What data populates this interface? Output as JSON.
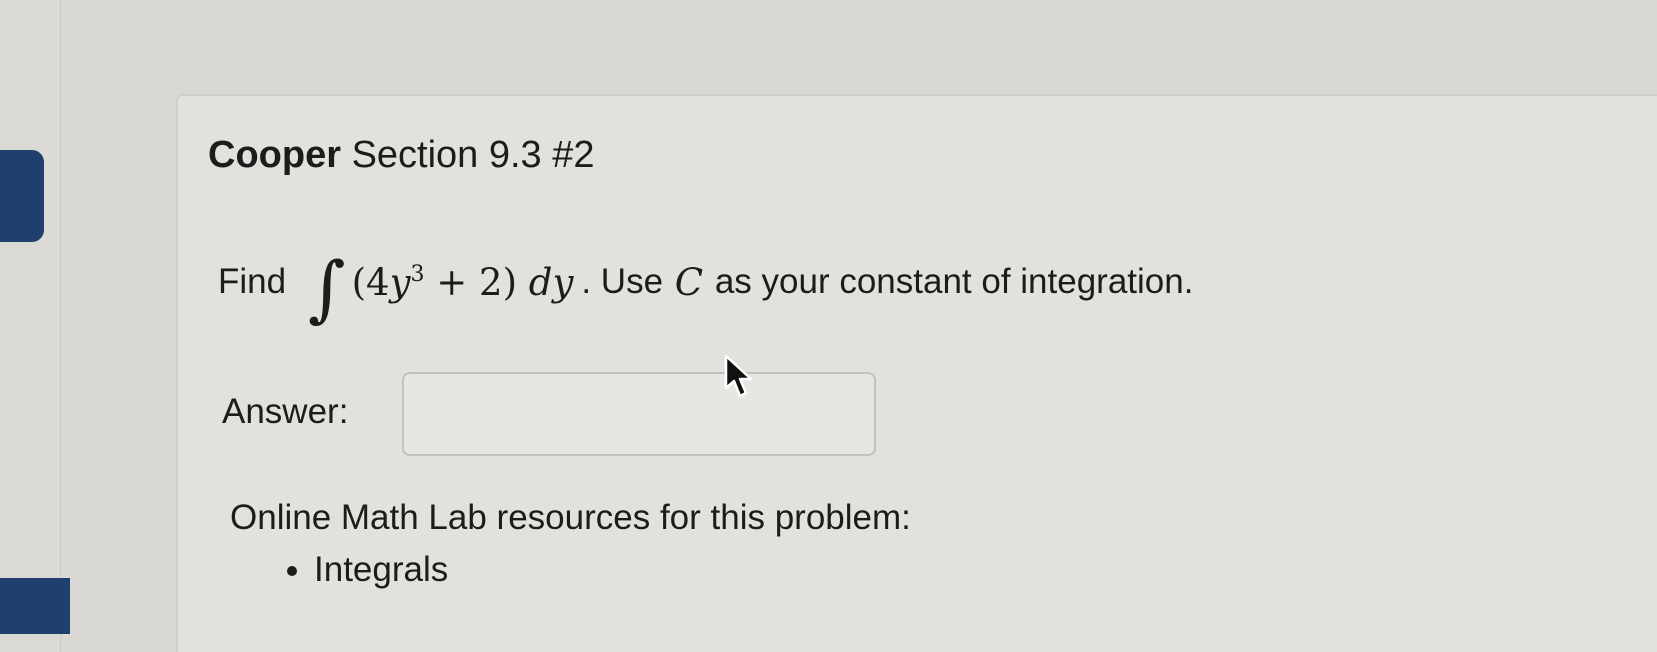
{
  "problem": {
    "title_bold": "Cooper",
    "title_rest": "Section 9.3 #2",
    "prompt_prefix": "Find",
    "integral_symbol": "∫",
    "expression_open": "(4",
    "expression_var": "y",
    "expression_exponent": "3",
    "expression_close": " + 2) ",
    "differential": "dy",
    "prompt_suffix_1": ". Use ",
    "constant": "C",
    "prompt_suffix_2": " as your constant of integration."
  },
  "answer": {
    "label": "Answer:",
    "value": "",
    "placeholder": ""
  },
  "resources": {
    "heading": "Online Math Lab resources for this problem:",
    "items": [
      {
        "label": "Integrals"
      }
    ]
  },
  "icons": {
    "pointer": "mouse-pointer-icon"
  },
  "colors": {
    "accent": "#1f3f6e",
    "text": "#1c1c1c",
    "background": "#e3e1dc"
  }
}
